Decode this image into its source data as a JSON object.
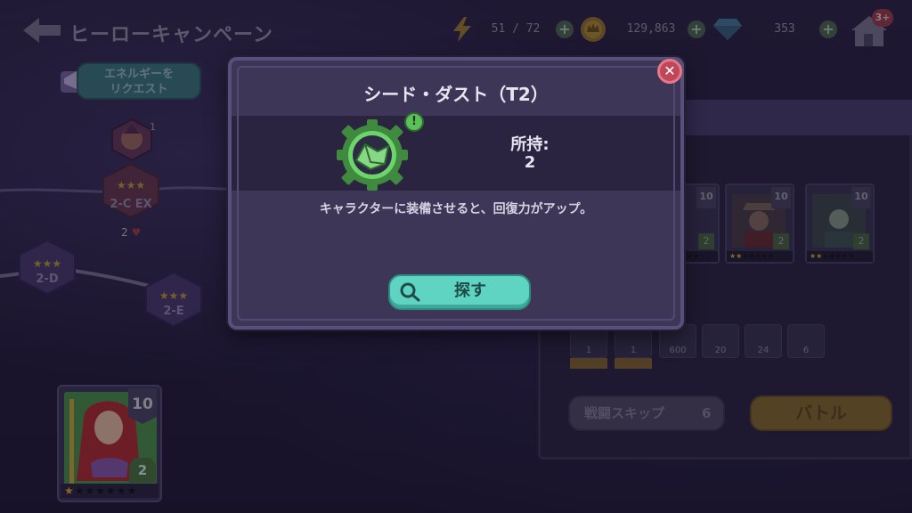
{
  "header": {
    "title": "ヒーローキャンペーン",
    "energy": "51 / 72",
    "gold": "129,863",
    "gems": "353",
    "home_badge": "3+"
  },
  "map": {
    "energy_request_label": "エネルギーを\nリクエスト",
    "boss_count": "1",
    "nodes": [
      {
        "label": "2-C EX"
      },
      {
        "label": "2-D"
      },
      {
        "label": "2-E"
      }
    ],
    "attempts": "2"
  },
  "hero": {
    "level": "10",
    "rank": "2",
    "stars_filled": 1,
    "stars_total": 7
  },
  "modal": {
    "title": "シード・ダスト（T2）",
    "owned_label": "所持:",
    "owned_count": "2",
    "description": "キャラクターに装備させると、回復力がアップ。",
    "search_label": "探す",
    "alert": "!",
    "close": "✕"
  },
  "right_panel": {
    "enemies": [
      {
        "level": "10",
        "rank": "2"
      },
      {
        "level": "10",
        "rank": "2"
      },
      {
        "level": "10",
        "rank": "2"
      }
    ],
    "rewards": [
      {
        "count": "1"
      },
      {
        "count": "1"
      },
      {
        "count": "600"
      },
      {
        "count": "20"
      },
      {
        "count": "24"
      },
      {
        "count": "6"
      }
    ],
    "skip_label": "戦闘スキップ",
    "skip_count": "6",
    "battle_label": "バトル"
  },
  "colors": {
    "accent_teal": "#5fd4c3",
    "close_red": "#c0475a",
    "gear_green": "#6cd46b"
  }
}
